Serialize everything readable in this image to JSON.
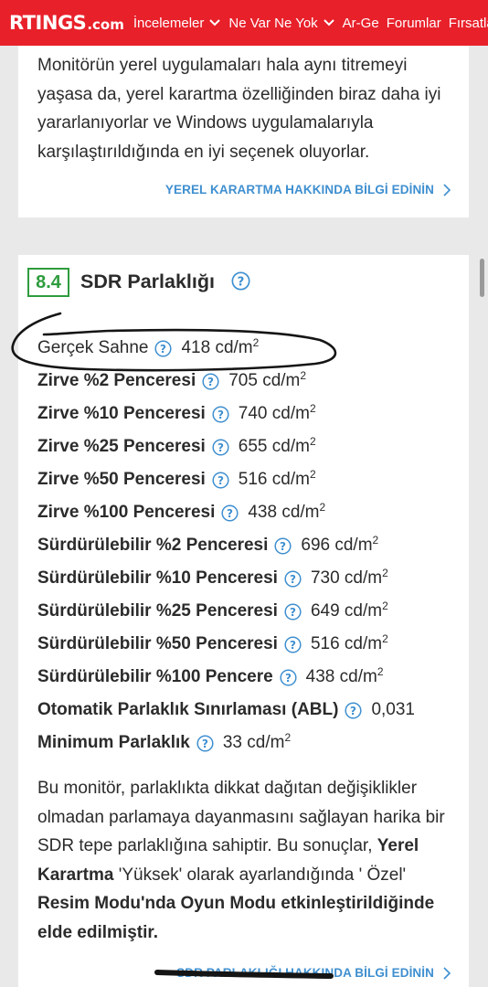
{
  "header": {
    "brand": "RTINGS",
    "brand_tld": ".com",
    "nav": [
      {
        "label": "İncelemeler",
        "has_dropdown": true
      },
      {
        "label": "Ne Var Ne Yok",
        "has_dropdown": true
      },
      {
        "label": "Ar-Ge",
        "has_dropdown": false
      },
      {
        "label": "Forumlar",
        "has_dropdown": false
      },
      {
        "label": "Fırsatlar",
        "has_dropdown": false
      }
    ]
  },
  "section_prev": {
    "text": "Monitörün yerel uygulamaları hala aynı titremeyi yaşasa da, yerel karartma özelliğinden biraz daha iyi yararlanıyorlar ve Windows uygulamalarıyla karşılaştırıldığında en iyi seçenek oluyorlar.",
    "learn_more": "YEREL KARARTMA HAKKINDA BİLGİ EDİNİN"
  },
  "sdr": {
    "score": "8.4",
    "title": "SDR Parlaklığı",
    "rows": [
      {
        "label": "Gerçek Sahne",
        "value": "418 cd/m",
        "unit_sup": "2"
      },
      {
        "label": "Zirve %2 Penceresi",
        "value": "705 cd/m",
        "unit_sup": "2"
      },
      {
        "label": "Zirve %10 Penceresi",
        "value": "740 cd/m",
        "unit_sup": "2"
      },
      {
        "label": "Zirve %25 Penceresi",
        "value": "655 cd/m",
        "unit_sup": "2"
      },
      {
        "label": "Zirve %50 Penceresi",
        "value": "516 cd/m",
        "unit_sup": "2"
      },
      {
        "label": "Zirve %100 Penceresi",
        "value": "438 cd/m",
        "unit_sup": "2"
      },
      {
        "label": "Sürdürülebilir %2 Penceresi",
        "value": "696 cd/m",
        "unit_sup": "2"
      },
      {
        "label": "Sürdürülebilir %10 Penceresi",
        "value": "730 cd/m",
        "unit_sup": "2"
      },
      {
        "label": "Sürdürülebilir %25 Penceresi",
        "value": "649 cd/m",
        "unit_sup": "2"
      },
      {
        "label": "Sürdürülebilir %50 Penceresi",
        "value": "516 cd/m",
        "unit_sup": "2"
      },
      {
        "label": "Sürdürülebilir %100 Pencere",
        "value": "438 cd/m",
        "unit_sup": "2"
      },
      {
        "label": "Otomatik Parlaklık Sınırlaması (ABL)",
        "value": "0,031",
        "unit_sup": ""
      },
      {
        "label": "Minimum Parlaklık",
        "value": "33 cd/m",
        "unit_sup": "2"
      }
    ],
    "summary": {
      "p1": "Bu monitör, parlaklıkta dikkat dağıtan değişiklikler olmadan parlamaya dayanmasını sağlayan harika bir SDR tepe parlaklığına sahiptir. Bu sonuçlar, ",
      "b1": "Yerel Karartma",
      "p2": " 'Yüksek' olarak ayarlandığında ' Özel' ",
      "b2": "Resim Modu'nda Oyun Modu etkinleştirildiğinde elde edilmiştir."
    },
    "learn_more": "SDR PARLAKLIĞI HAKKINDA BİLGİ EDİNİN"
  },
  "colors": {
    "header_bg": "#e8202a",
    "score_green": "#2e9c3e",
    "link_blue": "#3e8fd0",
    "help_blue": "#3e8fd0"
  }
}
